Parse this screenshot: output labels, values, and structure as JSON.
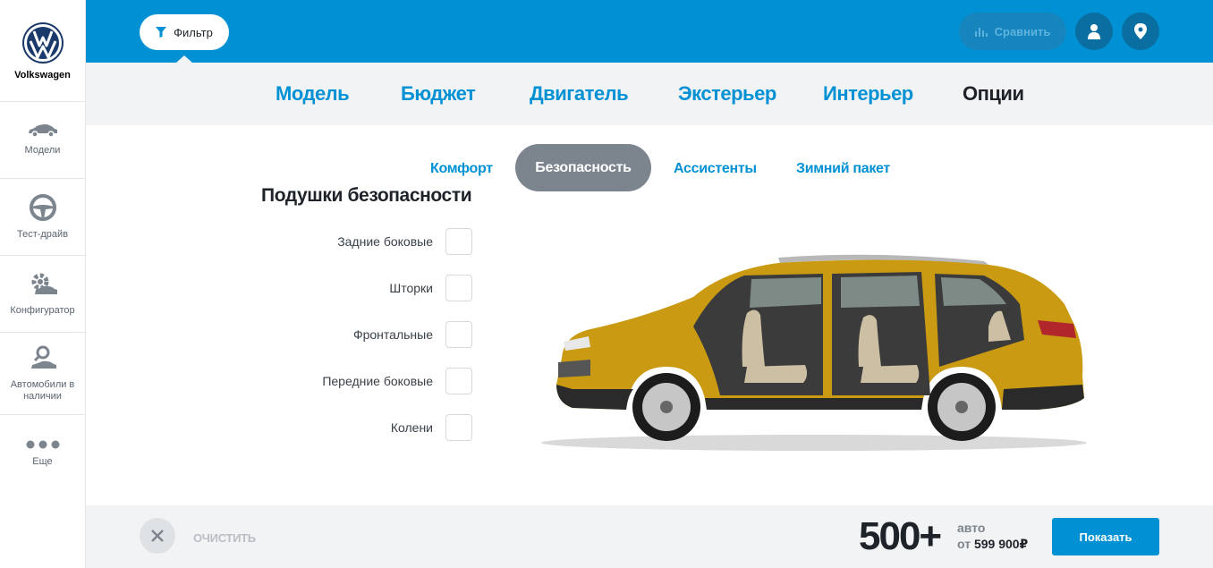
{
  "brand": {
    "name": "Volkswagen",
    "logo": "vw-logo"
  },
  "sidebar": {
    "items": [
      {
        "label": "Модели",
        "icon": "car-icon"
      },
      {
        "label": "Тест-драйв",
        "icon": "steering-wheel-icon"
      },
      {
        "label": "Конфигуратор",
        "icon": "gear-car-icon"
      },
      {
        "label": "Автомобили в наличии",
        "icon": "search-car-icon"
      },
      {
        "label": "Еще",
        "icon": "more-dots-icon"
      }
    ]
  },
  "topbar": {
    "filter_label": "Фильтр",
    "compare_label": "Сравнить"
  },
  "tabs": [
    {
      "label": "Модель"
    },
    {
      "label": "Бюджет"
    },
    {
      "label": "Двигатель"
    },
    {
      "label": "Экстерьер"
    },
    {
      "label": "Интерьер"
    },
    {
      "label": "Опции",
      "active": true
    }
  ],
  "subtabs": [
    {
      "label": "Комфорт"
    },
    {
      "label": "Безопасность",
      "active": true
    },
    {
      "label": "Ассистенты"
    },
    {
      "label": "Зимний пакет"
    }
  ],
  "section": {
    "title": "Подушки безопасности",
    "options": [
      {
        "label": "Задние боковые",
        "checked": false
      },
      {
        "label": "Шторки",
        "checked": false
      },
      {
        "label": "Фронтальные",
        "checked": false
      },
      {
        "label": "Передние боковые",
        "checked": false
      },
      {
        "label": "Колени",
        "checked": false
      }
    ]
  },
  "bottom": {
    "clear_label": "ОЧИСТИТЬ",
    "count": "500+",
    "count_unit": "авто",
    "price_prefix": "от",
    "price": "599 900₽",
    "show_label": "Показать"
  },
  "colors": {
    "accent": "#0091d5",
    "pill": "#7c858e",
    "car_body": "#c99a12"
  }
}
